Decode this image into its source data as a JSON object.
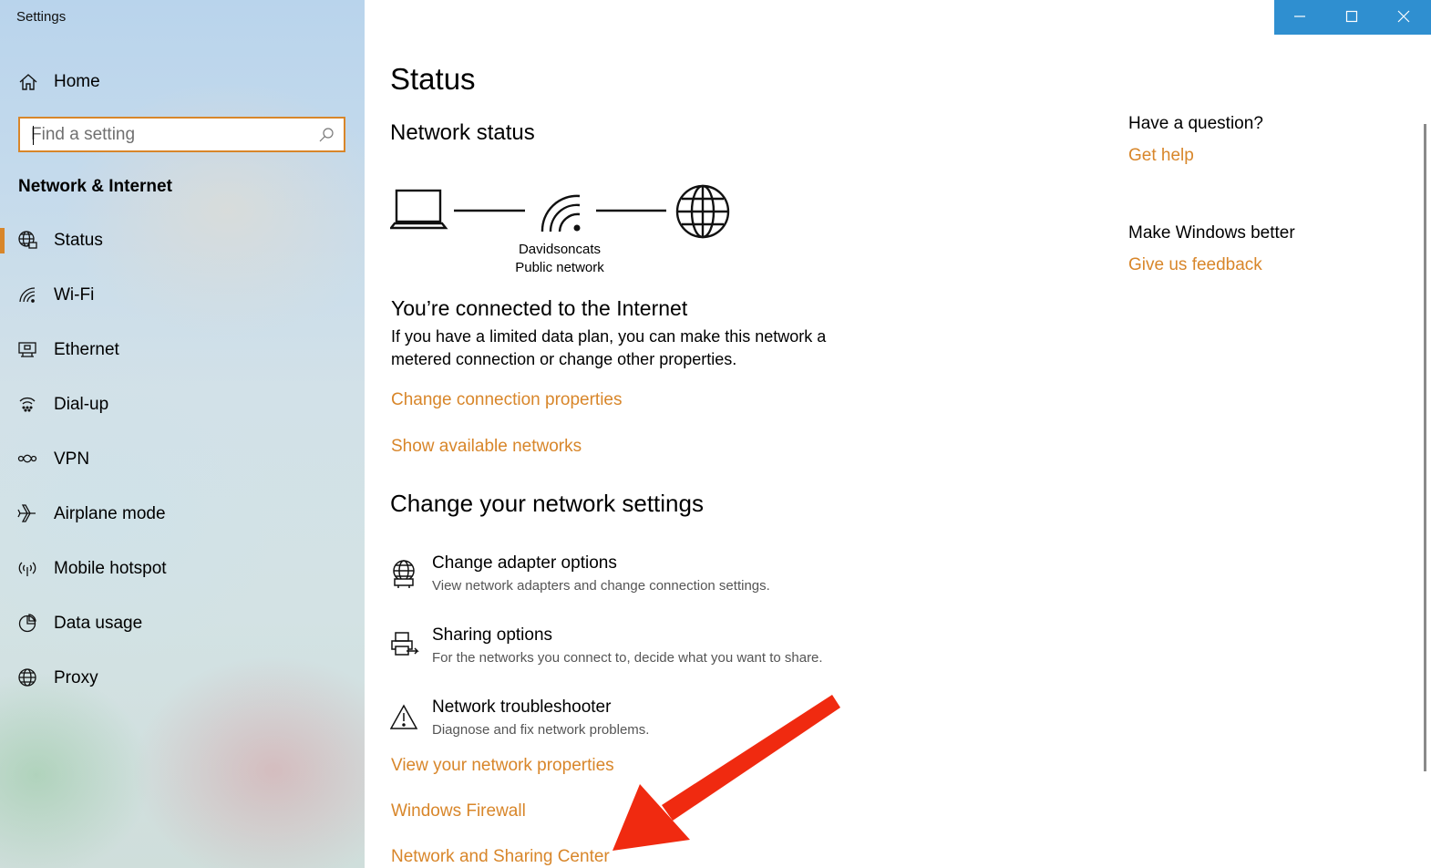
{
  "app": {
    "title": "Settings"
  },
  "sidebar": {
    "home_label": "Home",
    "search_placeholder": "Find a setting",
    "section_title": "Network & Internet",
    "items": [
      {
        "label": "Status",
        "icon": "globe-grid-icon",
        "selected": true
      },
      {
        "label": "Wi-Fi",
        "icon": "wifi-icon",
        "selected": false
      },
      {
        "label": "Ethernet",
        "icon": "ethernet-icon",
        "selected": false
      },
      {
        "label": "Dial-up",
        "icon": "dialup-icon",
        "selected": false
      },
      {
        "label": "VPN",
        "icon": "vpn-icon",
        "selected": false
      },
      {
        "label": "Airplane mode",
        "icon": "airplane-icon",
        "selected": false
      },
      {
        "label": "Mobile hotspot",
        "icon": "hotspot-icon",
        "selected": false
      },
      {
        "label": "Data usage",
        "icon": "data-usage-icon",
        "selected": false
      },
      {
        "label": "Proxy",
        "icon": "globe-icon",
        "selected": false
      }
    ]
  },
  "main": {
    "page_title": "Status",
    "network_status_title": "Network status",
    "network_name": "Davidsoncats",
    "network_type": "Public network",
    "connected_title": "You’re connected to the Internet",
    "connected_desc": "If you have a limited data plan, you can make this network a metered connection or change other properties.",
    "link_change_connection": "Change connection properties",
    "link_show_networks": "Show available networks",
    "change_settings_title": "Change your network settings",
    "settings": [
      {
        "title": "Change adapter options",
        "desc": "View network adapters and change connection settings.",
        "icon": "adapter-icon"
      },
      {
        "title": "Sharing options",
        "desc": "For the networks you connect to, decide what you want to share.",
        "icon": "sharing-icon"
      },
      {
        "title": "Network troubleshooter",
        "desc": "Diagnose and fix network problems.",
        "icon": "warning-icon"
      }
    ],
    "link_view_properties": "View your network properties",
    "link_firewall": "Windows Firewall",
    "link_sharing_center": "Network and Sharing Center"
  },
  "right_panel": {
    "question_title": "Have a question?",
    "get_help": "Get help",
    "better_title": "Make Windows better",
    "feedback": "Give us feedback"
  },
  "colors": {
    "accent": "#d8862a",
    "titlebar_controls": "#2f8fd0",
    "annotation_arrow": "#f02a10"
  }
}
